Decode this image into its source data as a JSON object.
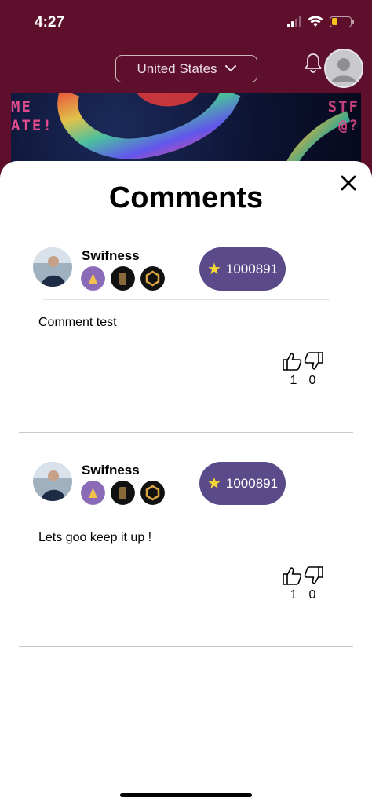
{
  "status_bar": {
    "time": "4:27"
  },
  "header": {
    "country": "United States"
  },
  "banner": {
    "left_text_line1": "ME",
    "left_text_line2": "ATE!",
    "right_text_line1": "STF",
    "right_text_line2": "@?"
  },
  "sheet": {
    "title": "Comments"
  },
  "comments": [
    {
      "username": "Swifness",
      "points": "1000891",
      "text": "Comment test",
      "likes": "1",
      "dislikes": "0"
    },
    {
      "username": "Swifness",
      "points": "1000891",
      "text": "Lets goo keep it up !",
      "likes": "1",
      "dislikes": "0"
    }
  ],
  "colors": {
    "header_bg": "#5e0f2b",
    "pill_bg": "#5a4a8a",
    "star": "#f5d833",
    "battery": "#f5c518"
  },
  "icons": [
    "signal-icon",
    "wifi-icon",
    "battery-icon",
    "chevron-down-icon",
    "bell-icon",
    "close-icon",
    "star-icon",
    "thumbs-up-icon",
    "thumbs-down-icon"
  ]
}
